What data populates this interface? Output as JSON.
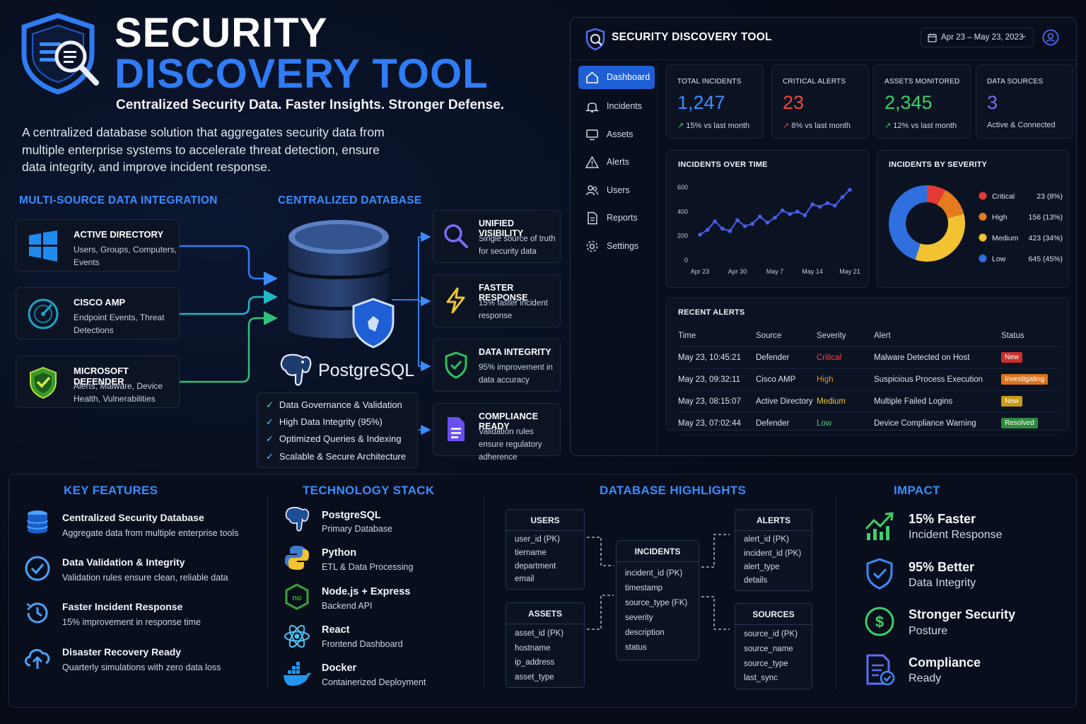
{
  "hero": {
    "title_line1": "SECURITY",
    "title_line2": "DISCOVERY TOOL",
    "tagline": "Centralized Security Data. Faster Insights. Stronger Defense.",
    "description": "A centralized database solution that aggregates security data from multiple enterprise systems to accelerate threat detection, ensure data integrity, and improve incident response."
  },
  "integration": {
    "heading": "MULTI-SOURCE DATA INTEGRATION",
    "sources": [
      {
        "title": "ACTIVE DIRECTORY",
        "desc": "Users, Groups, Computers, Events",
        "icon": "windows-icon"
      },
      {
        "title": "CISCO AMP",
        "desc": "Endpoint Events, Threat Detections",
        "icon": "radar-icon"
      },
      {
        "title": "MICROSOFT DEFENDER",
        "desc": "Alerts, Malware, Device Health, Vulnerabilities",
        "icon": "defender-shield-icon"
      }
    ]
  },
  "database": {
    "heading": "CENTRALIZED DATABASE",
    "engine": "PostgreSQL",
    "checks": [
      "Data Governance & Validation",
      "High Data Integrity (95%)",
      "Optimized Queries & Indexing",
      "Scalable & Secure Architecture"
    ]
  },
  "benefits": [
    {
      "title": "UNIFIED VISIBILITY",
      "desc": "Single source of truth for security data",
      "icon": "magnifier-icon"
    },
    {
      "title": "FASTER RESPONSE",
      "desc": "15% faster incident response",
      "icon": "lightning-icon"
    },
    {
      "title": "DATA INTEGRITY",
      "desc": "95% improvement in data accuracy",
      "icon": "shield-check-icon"
    },
    {
      "title": "COMPLIANCE READY",
      "desc": "Validation rules ensure regulatory adherence",
      "icon": "document-icon"
    }
  ],
  "dashboard": {
    "title": "SECURITY DISCOVERY TOOL",
    "date_range": "Apr 23 – May 23, 2023",
    "nav": [
      "Dashboard",
      "Incidents",
      "Assets",
      "Alerts",
      "Users",
      "Reports",
      "Settings"
    ],
    "stats": [
      {
        "label": "TOTAL INCIDENTS",
        "value": "1,247",
        "sub": "15% vs last month",
        "trend": "↗",
        "color": "#3b8cff",
        "trend_color": "#3ecf6a"
      },
      {
        "label": "CRITICAL ALERTS",
        "value": "23",
        "sub": "8% vs last month",
        "trend": "↗",
        "color": "#f0473e",
        "trend_color": "#f0473e"
      },
      {
        "label": "ASSETS MONITORED",
        "value": "2,345",
        "sub": "12% vs last month",
        "trend": "↗",
        "color": "#3ecf6a",
        "trend_color": "#3ecf6a"
      },
      {
        "label": "DATA SOURCES",
        "value": "3",
        "sub": "Active & Connected",
        "trend": "",
        "color": "#7a6cf5",
        "trend_color": "#cbd3e1"
      }
    ],
    "line_chart_title": "INCIDENTS OVER TIME",
    "donut_title": "INCIDENTS BY SEVERITY",
    "recent_alerts": {
      "title": "RECENT ALERTS",
      "columns": [
        "Time",
        "Source",
        "Severity",
        "Alert",
        "Status"
      ],
      "rows": [
        {
          "time": "May 23, 10:45:21",
          "source": "Defender",
          "severity": "Critical",
          "sev_color": "#f0473e",
          "alert": "Malware Detected on Host",
          "status": "New",
          "status_color": "#c9302c"
        },
        {
          "time": "May 23, 09:32:11",
          "source": "Cisco AMP",
          "severity": "High",
          "sev_color": "#f28a2e",
          "alert": "Suspicious Process Execution",
          "status": "Investigating",
          "status_color": "#d9731f"
        },
        {
          "time": "May 23, 08:15:07",
          "source": "Active Directory",
          "severity": "Medium",
          "sev_color": "#f2c230",
          "alert": "Multiple Failed Logins",
          "status": "New",
          "status_color": "#c99a12"
        },
        {
          "time": "May 23, 07:02:44",
          "source": "Defender",
          "severity": "Low",
          "sev_color": "#3ecf6a",
          "alert": "Device Compliance Warning",
          "status": "Resolved",
          "status_color": "#2e8b3e"
        }
      ]
    }
  },
  "chart_data": [
    {
      "type": "line",
      "title": "INCIDENTS OVER TIME",
      "x_ticks": [
        "Apr 23",
        "Apr 30",
        "May 7",
        "May 14",
        "May 21"
      ],
      "y_ticks": [
        0,
        200,
        400,
        600
      ],
      "ylim": [
        0,
        600
      ],
      "series": [
        {
          "values": [
            210,
            250,
            320,
            260,
            240,
            330,
            280,
            300,
            360,
            310,
            350,
            410,
            380,
            400,
            370,
            460,
            440,
            470,
            450,
            520,
            580
          ]
        }
      ],
      "color": "#4b5cf0"
    },
    {
      "type": "pie",
      "title": "INCIDENTS BY SEVERITY",
      "categories": [
        "Critical",
        "High",
        "Medium",
        "Low"
      ],
      "values": [
        23,
        156,
        423,
        645
      ],
      "labels": [
        "23 (8%)",
        "156 (13%)",
        "423 (34%)",
        "645 (45%)"
      ],
      "percents": [
        8,
        13,
        34,
        45
      ],
      "colors": [
        "#e53935",
        "#e67a1f",
        "#f2c230",
        "#2f6fe0"
      ]
    }
  ],
  "key_features": {
    "heading": "KEY FEATURES",
    "items": [
      {
        "title": "Centralized Security Database",
        "desc": "Aggregate data from multiple enterprise tools"
      },
      {
        "title": "Data Validation & Integrity",
        "desc": "Validation rules ensure clean, reliable data"
      },
      {
        "title": "Faster Incident Response",
        "desc": "15% improvement in response time"
      },
      {
        "title": "Disaster Recovery Ready",
        "desc": "Quarterly simulations with zero data loss"
      }
    ]
  },
  "tech_stack": {
    "heading": "TECHNOLOGY STACK",
    "items": [
      {
        "title": "PostgreSQL",
        "desc": "Primary Database"
      },
      {
        "title": "Python",
        "desc": "ETL & Data Processing"
      },
      {
        "title": "Node.js + Express",
        "desc": "Backend API"
      },
      {
        "title": "React",
        "desc": "Frontend Dashboard"
      },
      {
        "title": "Docker",
        "desc": "Containerized Deployment"
      }
    ]
  },
  "db_highlights": {
    "heading": "DATABASE HIGHLIGHTS",
    "tables": {
      "users": {
        "name": "USERS",
        "fields": [
          "user_id (PK)",
          "tiername",
          "department",
          "email"
        ]
      },
      "assets": {
        "name": "ASSETS",
        "fields": [
          "asset_id (PK)",
          "hostname",
          "ip_address",
          "asset_type"
        ]
      },
      "incidents": {
        "name": "INCIDENTS",
        "fields": [
          "incident_id (PK)",
          "timestamp",
          "source_type (FK)",
          "severity",
          "description",
          "status"
        ]
      },
      "alerts": {
        "name": "ALERTS",
        "fields": [
          "alert_id (PK)",
          "incident_id (PK)",
          "alert_type",
          "details"
        ]
      },
      "sources": {
        "name": "SOURCES",
        "fields": [
          "source_id (PK)",
          "source_name",
          "source_type",
          "last_sync"
        ]
      }
    }
  },
  "impact": {
    "heading": "IMPACT",
    "items": [
      {
        "title": "15% Faster",
        "desc": "Incident Response"
      },
      {
        "title": "95% Better",
        "desc": "Data Integrity"
      },
      {
        "title": "Stronger Security",
        "desc": "Posture"
      },
      {
        "title": "Compliance",
        "desc": "Ready"
      }
    ]
  }
}
